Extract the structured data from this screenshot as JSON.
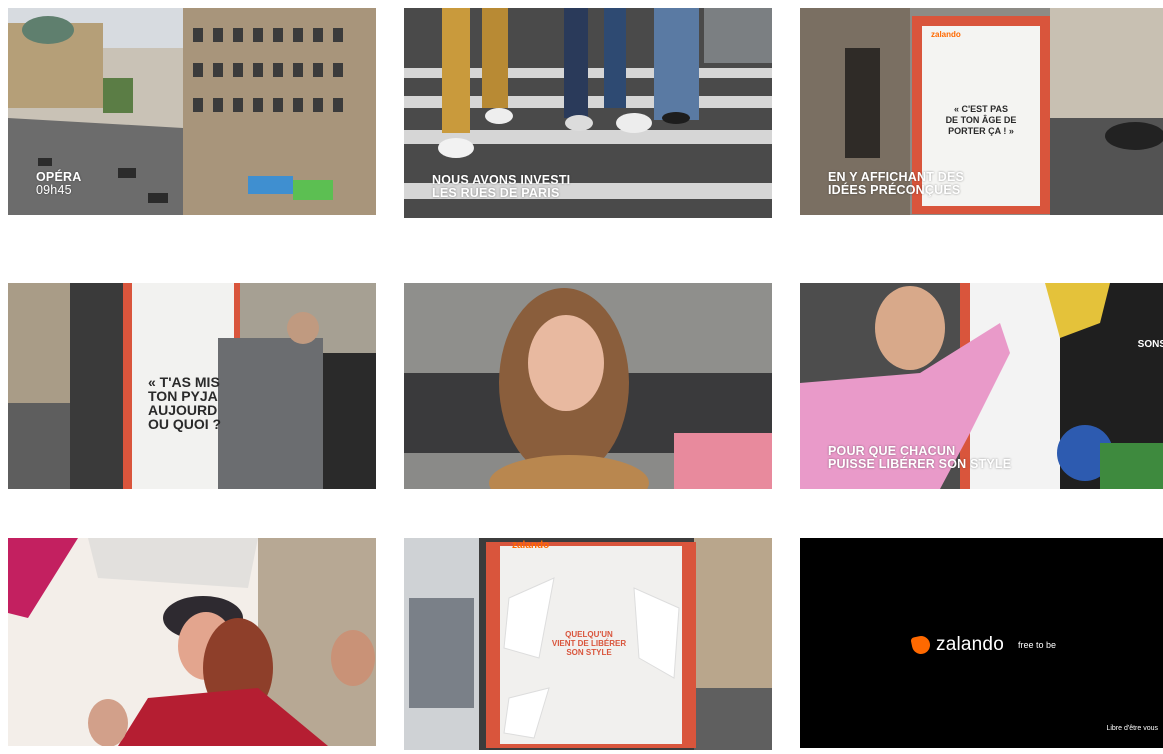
{
  "frames": [
    {
      "caption_line1": "OPÉRA",
      "caption_line2": "09h45"
    },
    {
      "caption_line1": "NOUS AVONS INVESTI",
      "caption_line2": "LES RUES DE PARIS"
    },
    {
      "caption_line1": "EN Y AFFICHANT DES",
      "caption_line2": "IDÉES PRÉCONÇUES",
      "poster_line1": "« C'EST PAS",
      "poster_line2": "DE TON ÂGE DE",
      "poster_line3": "PORTER ÇA ! »",
      "brand": "zalando"
    },
    {
      "poster_line1": "« T'AS MIS",
      "poster_line2": "TON PYJA",
      "poster_line3": "AUJOURD",
      "poster_line4": "OU QUOI ?"
    },
    {},
    {
      "caption_line1": "POUR QUE CHACUN",
      "caption_line2": "PUISSE LIBÉRER SON STYLE",
      "sign": "SONS"
    },
    {},
    {
      "brand": "zalando",
      "poster_line1": "QUELQU'UN",
      "poster_line2": "VIENT DE LIBÉRER",
      "poster_line3": "SON STYLE"
    },
    {
      "logo_text": "zalando",
      "tagline": "free to be",
      "note": "Libre d'être vous"
    }
  ],
  "colors": {
    "brand_orange": "#ff6900",
    "poster_red": "#d9553c",
    "background": "#ffffff"
  }
}
